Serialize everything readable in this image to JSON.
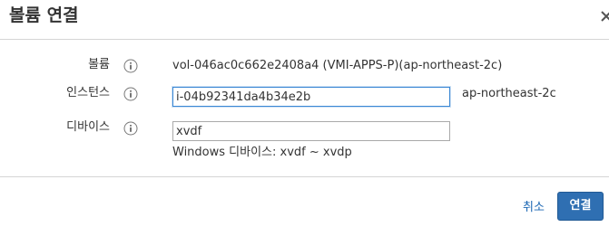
{
  "dialog": {
    "title": "볼륨 연결",
    "close_glyph": "×"
  },
  "form": {
    "volume": {
      "label": "볼륨",
      "value": "vol-046ac0c662e2408a4 (VMI-APPS-P)(ap-northeast-2c)"
    },
    "instance": {
      "label": "인스턴스",
      "value": "i-04b92341da4b34e2b",
      "zone": "ap-northeast-2c"
    },
    "device": {
      "label": "디바이스",
      "value": "xvdf",
      "hint": "Windows 디바이스: xvdf ~ xvdp"
    }
  },
  "footer": {
    "cancel_label": "취소",
    "connect_label": "연결"
  },
  "colors": {
    "primary_button": "#2f6fb2",
    "link": "#1a66b3",
    "focus_border": "#3a87d4"
  },
  "icons": {
    "info": "info-circle-icon",
    "close": "close-icon"
  }
}
